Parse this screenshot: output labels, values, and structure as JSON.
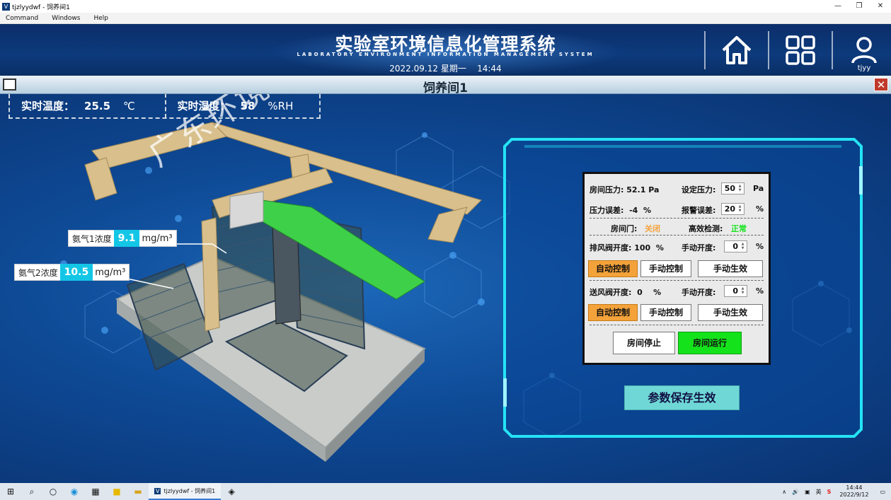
{
  "window": {
    "title": "tjzlyydwf - 饲养间1",
    "minimize": "—",
    "restore": "❐",
    "close": "✕"
  },
  "menu": [
    "Command",
    "Windows",
    "Help"
  ],
  "header": {
    "title_cn": "实验室环境信息化管理系统",
    "title_en": "LABORATORY ENVIRONMENT INFORMATION MANAGEMENT SYSTEM",
    "date": "2022.09.12",
    "weekday": "星期一",
    "time": "14:44",
    "user": "tjyy",
    "icons": [
      "home-icon",
      "grid-icon",
      "user-icon"
    ]
  },
  "room": {
    "title": "饲养间1",
    "close": "✕"
  },
  "readings": {
    "temp_label": "实时温度：",
    "temp_value": "25.5",
    "temp_unit": "℃",
    "hum_label": "实时湿度：",
    "hum_value": "58",
    "hum_unit": "%RH"
  },
  "gas": [
    {
      "label": "氨气1浓度",
      "value": "9.1",
      "unit": "mg/m³"
    },
    {
      "label": "氨气2浓度",
      "value": "10.5",
      "unit": "mg/m³"
    }
  ],
  "control": {
    "room_pressure_label": "房间压力:",
    "room_pressure_value": "52.1",
    "room_pressure_unit": "Pa",
    "set_pressure_label": "设定压力:",
    "set_pressure_value": "50",
    "set_pressure_unit": "Pa",
    "pressure_error_label": "压力误差:",
    "pressure_error_value": "-4",
    "pressure_error_unit": "%",
    "alarm_error_label": "报警误差:",
    "alarm_error_value": "20",
    "alarm_error_unit": "%",
    "door_label": "房间门:",
    "door_value": "关闭",
    "hepa_label": "高效检测:",
    "hepa_value": "正常",
    "exhaust_label": "排风阀开度:",
    "exhaust_value": "100",
    "exhaust_unit": "%",
    "manual_open_label": "手动开度:",
    "exhaust_manual_value": "0",
    "exhaust_manual_unit": "%",
    "supply_label": "送风阀开度:",
    "supply_value": "0",
    "supply_unit": "%",
    "supply_manual_value": "0",
    "supply_manual_unit": "%",
    "auto_btn": "自动控制",
    "manual_btn": "手动控制",
    "apply_btn": "手动生效",
    "stop_btn": "房间停止",
    "run_btn": "房间运行"
  },
  "save_btn": "参数保存生效",
  "watermark": "广东环境实验室科技有限公司",
  "taskbar": {
    "app_label": "tjzlyydwf - 饲养间1",
    "ime": "英",
    "time": "14:44",
    "date": "2022/9/12"
  },
  "colors": {
    "accent_orange": "#f4a23a",
    "run_green": "#14e31b",
    "door_closed": "#f4a23a",
    "hepa_ok": "#14e31b",
    "gas_value_bg": "#14c6e6"
  }
}
